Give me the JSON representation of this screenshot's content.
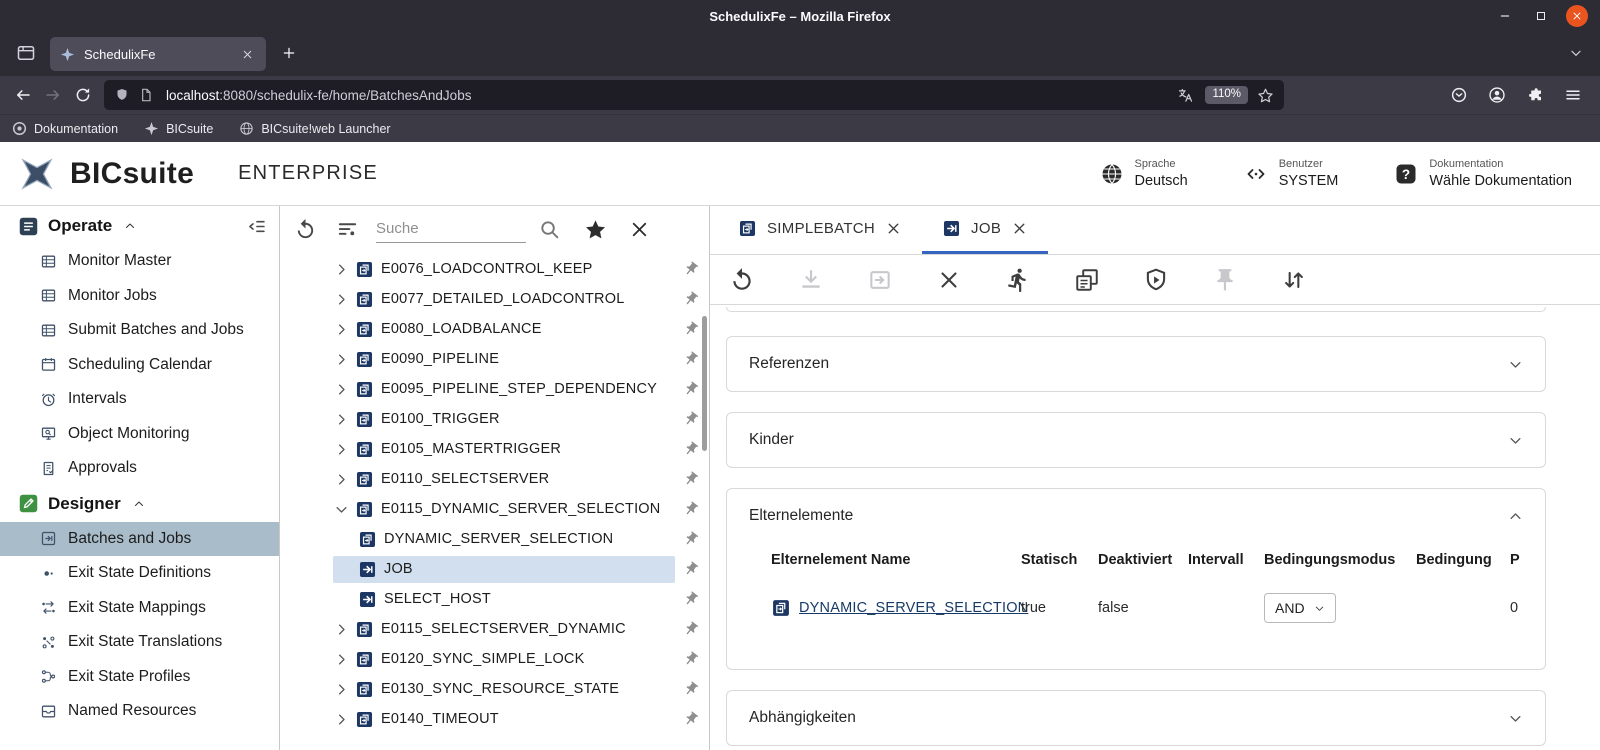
{
  "browser": {
    "window_title": "SchedulixFe – Mozilla Firefox",
    "tab": {
      "title": "SchedulixFe"
    },
    "url": {
      "host": "localhost",
      "path": ":8080/schedulix-fe/home/BatchesAndJobs"
    },
    "zoom_level": "110%",
    "bookmarks": [
      {
        "label": "Dokumentation",
        "icon": "doc-circle"
      },
      {
        "label": "BICsuite",
        "icon": "bic-star"
      },
      {
        "label": "BICsuite!web Launcher",
        "icon": "globe"
      }
    ]
  },
  "app_header": {
    "brand": "BICsuite",
    "edition": "ENTERPRISE",
    "meta": [
      {
        "id": "language",
        "icon": "globe-dark",
        "label": "Sprache",
        "value": "Deutsch"
      },
      {
        "id": "user",
        "icon": "code",
        "label": "Benutzer",
        "value": "SYSTEM"
      },
      {
        "id": "documentation",
        "icon": "help-box",
        "label": "Dokumentation",
        "value": "Wähle Dokumentation"
      }
    ]
  },
  "sidebar": {
    "sections": [
      {
        "label": "Operate",
        "icon": "operate",
        "items": [
          {
            "label": "Monitor Master",
            "icon": "table"
          },
          {
            "label": "Monitor Jobs",
            "icon": "table"
          },
          {
            "label": "Submit Batches and Jobs",
            "icon": "table"
          },
          {
            "label": "Scheduling Calendar",
            "icon": "calendar"
          },
          {
            "label": "Intervals",
            "icon": "clock"
          },
          {
            "label": "Object Monitoring",
            "icon": "monitor"
          },
          {
            "label": "Approvals",
            "icon": "approvals"
          }
        ]
      },
      {
        "label": "Designer",
        "icon": "designer",
        "items": [
          {
            "label": "Batches and Jobs",
            "icon": "jobnav",
            "selected": true
          },
          {
            "label": "Exit State Definitions",
            "icon": "dot"
          },
          {
            "label": "Exit State Mappings",
            "icon": "mapping"
          },
          {
            "label": "Exit State Translations",
            "icon": "translate"
          },
          {
            "label": "Exit State Profiles",
            "icon": "branch"
          },
          {
            "label": "Named Resources",
            "icon": "drawer"
          }
        ]
      }
    ]
  },
  "tree_panel": {
    "search_placeholder": "Suche",
    "toolbar": [
      "refresh",
      "filter",
      "search",
      "favorites",
      "clear"
    ],
    "items": [
      {
        "name": "E0076_LOADCONTROL_KEEP",
        "icon": "batch",
        "chevron": "right"
      },
      {
        "name": "E0077_DETAILED_LOADCONTROL",
        "icon": "batch",
        "chevron": "right"
      },
      {
        "name": "E0080_LOADBALANCE",
        "icon": "batch",
        "chevron": "right"
      },
      {
        "name": "E0090_PIPELINE",
        "icon": "batch",
        "chevron": "right"
      },
      {
        "name": "E0095_PIPELINE_STEP_DEPENDENCY",
        "icon": "batch",
        "chevron": "right"
      },
      {
        "name": "E0100_TRIGGER",
        "icon": "batch",
        "chevron": "right"
      },
      {
        "name": "E0105_MASTERTRIGGER",
        "icon": "batch",
        "chevron": "right"
      },
      {
        "name": "E0110_SELECTSERVER",
        "icon": "batch",
        "chevron": "right"
      },
      {
        "name": "E0115_DYNAMIC_SERVER_SELECTION",
        "icon": "batch",
        "chevron": "down"
      },
      {
        "name": "DYNAMIC_SERVER_SELECTION",
        "icon": "batch",
        "chevron": "none",
        "child": true
      },
      {
        "name": "JOB",
        "icon": "job",
        "chevron": "none",
        "child": true,
        "selected": true
      },
      {
        "name": "SELECT_HOST",
        "icon": "job",
        "chevron": "none",
        "child": true
      },
      {
        "name": "E0115_SELECTSERVER_DYNAMIC",
        "icon": "batch",
        "chevron": "right"
      },
      {
        "name": "E0120_SYNC_SIMPLE_LOCK",
        "icon": "batch",
        "chevron": "right"
      },
      {
        "name": "E0130_SYNC_RESOURCE_STATE",
        "icon": "batch",
        "chevron": "right"
      },
      {
        "name": "E0140_TIMEOUT",
        "icon": "batch",
        "chevron": "right"
      }
    ]
  },
  "detail_panel": {
    "tabs": [
      {
        "label": "SIMPLEBATCH",
        "icon": "batch",
        "active": false
      },
      {
        "label": "JOB",
        "icon": "job",
        "active": true
      }
    ],
    "toolbar": [
      {
        "name": "undo",
        "icon": "undo",
        "disabled": false
      },
      {
        "name": "save",
        "icon": "download",
        "disabled": true
      },
      {
        "name": "resubmit",
        "icon": "resubmit",
        "disabled": true
      },
      {
        "name": "close",
        "icon": "close",
        "disabled": false
      },
      {
        "name": "run",
        "icon": "run",
        "disabled": false
      },
      {
        "name": "hierarchy",
        "icon": "hierarchy",
        "disabled": false
      },
      {
        "name": "approval-run",
        "icon": "shield-play",
        "disabled": false
      },
      {
        "name": "pin",
        "icon": "pin",
        "disabled": true
      },
      {
        "name": "sort",
        "icon": "sort",
        "disabled": false
      }
    ],
    "sections": [
      {
        "title": "Referenzen",
        "expanded": false
      },
      {
        "title": "Kinder",
        "expanded": false
      },
      {
        "title": "Elternelemente",
        "expanded": true,
        "has_table": true
      },
      {
        "title": "Abhängigkeiten",
        "expanded": false
      }
    ],
    "parents_table": {
      "columns": [
        "Elternelement Name",
        "Statisch",
        "Deaktiviert",
        "Intervall",
        "Bedingungsmodus",
        "Bedingung",
        "P"
      ],
      "rows": [
        {
          "icon": "batch",
          "name": "DYNAMIC_SERVER_SELECTION",
          "statisch": "true",
          "deaktiviert": "false",
          "intervall": "",
          "bedingungsmodus": "AND",
          "bedingung": "",
          "p": "0"
        }
      ]
    }
  }
}
